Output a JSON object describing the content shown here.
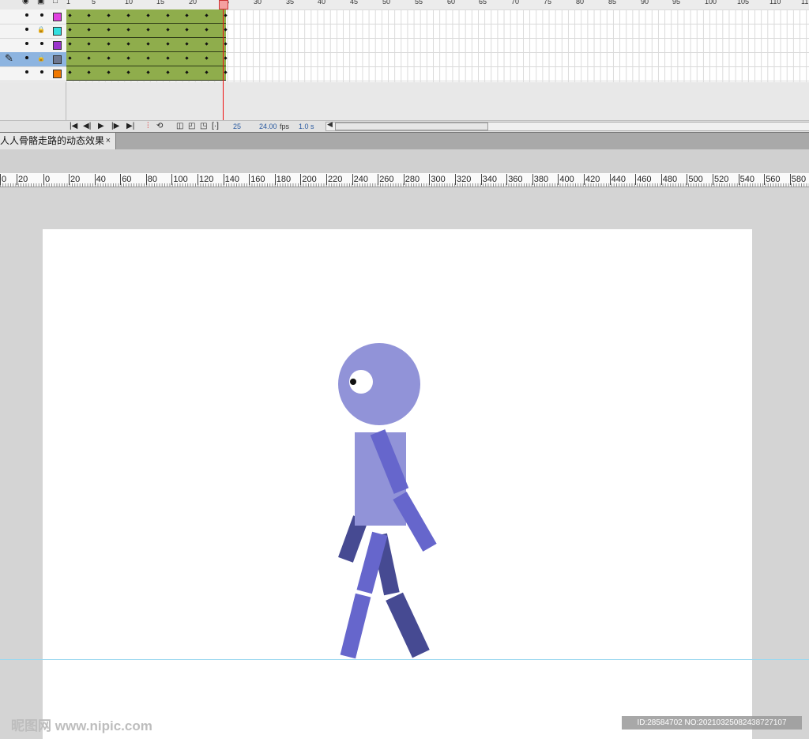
{
  "timeline": {
    "frame_numbers": [
      "1",
      "5",
      "10",
      "15",
      "20",
      "25",
      "30",
      "35",
      "40",
      "45",
      "50",
      "55",
      "60",
      "65",
      "70",
      "75",
      "80",
      "85",
      "90",
      "95",
      "100",
      "105",
      "110",
      "11"
    ],
    "header_icons": [
      "eye-icon",
      "lock-icon",
      "outline-icon"
    ],
    "layers": [
      {
        "color": "#e040e0",
        "locked": false
      },
      {
        "color": "#33e0e0",
        "locked": true
      },
      {
        "color": "#9a33cc",
        "locked": false
      },
      {
        "color": "#6d7790",
        "locked": true,
        "selected": true
      },
      {
        "color": "#f07800",
        "locked": false
      }
    ],
    "toolbar": {
      "current_frame": "25",
      "fps_value": "24.00",
      "fps_unit": "fps",
      "elapsed": "1.0 s"
    }
  },
  "document": {
    "tab_title": "人人骨骼走路的动态效果",
    "close_glyph": "×"
  },
  "ruler": {
    "labels": [
      "0",
      "20",
      "0",
      "20",
      "40",
      "60",
      "80",
      "100",
      "120",
      "140",
      "160",
      "180",
      "200",
      "220",
      "240",
      "260",
      "280",
      "300",
      "320",
      "340",
      "360",
      "380",
      "400",
      "420",
      "440",
      "460",
      "480",
      "500",
      "520",
      "540",
      "560",
      "580"
    ]
  },
  "colors": {
    "head": "#9193d8",
    "body": "#9193d8",
    "limb_front": "#6666cc",
    "limb_back": "#464a92",
    "stage": "#ffffff",
    "guide": "#9ad8f0"
  },
  "watermark": {
    "left": "昵图网 www.nipic.com",
    "right": "ID:28584702 NO:20210325082438727107"
  }
}
